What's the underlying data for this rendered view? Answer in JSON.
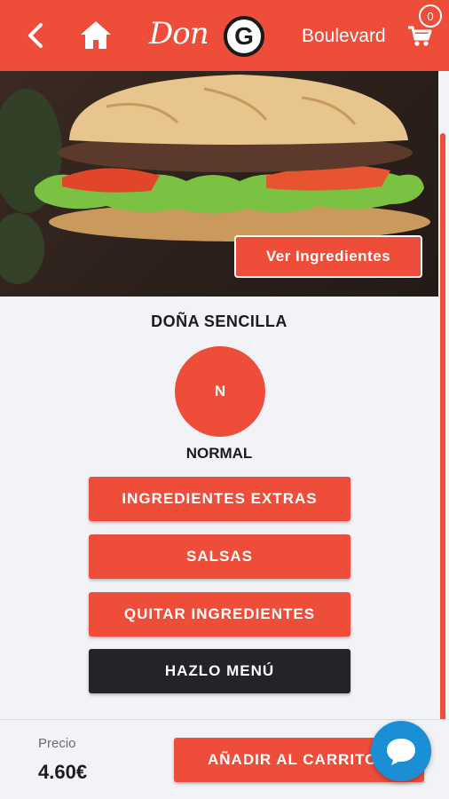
{
  "header": {
    "logo_text": "Don",
    "logo_letter": "G",
    "store_name": "Boulevard",
    "cart_count": "0",
    "icons": {
      "back": "chevron-left-icon",
      "home": "home-icon",
      "cart": "cart-icon"
    }
  },
  "product": {
    "view_ingredients_label": "Ver Ingredientes",
    "name": "DOÑA SENCILLA",
    "size_code": "N",
    "size_name": "NORMAL"
  },
  "options": [
    {
      "label": "INGREDIENTES EXTRAS",
      "style": "red"
    },
    {
      "label": "SALSAS",
      "style": "red"
    },
    {
      "label": "QUITAR INGREDIENTES",
      "style": "red"
    },
    {
      "label": "HAZLO MENÚ",
      "style": "dark"
    }
  ],
  "footer": {
    "price_label": "Precio",
    "price_value": "4.60€",
    "add_to_cart_label": "AÑADIR AL CARRITO",
    "chat_icon": "chat-bubble-icon"
  },
  "colors": {
    "accent": "#ee4d3a",
    "dark_button": "#222427",
    "chat": "#1b8fd6",
    "background": "#f2f3f7"
  }
}
